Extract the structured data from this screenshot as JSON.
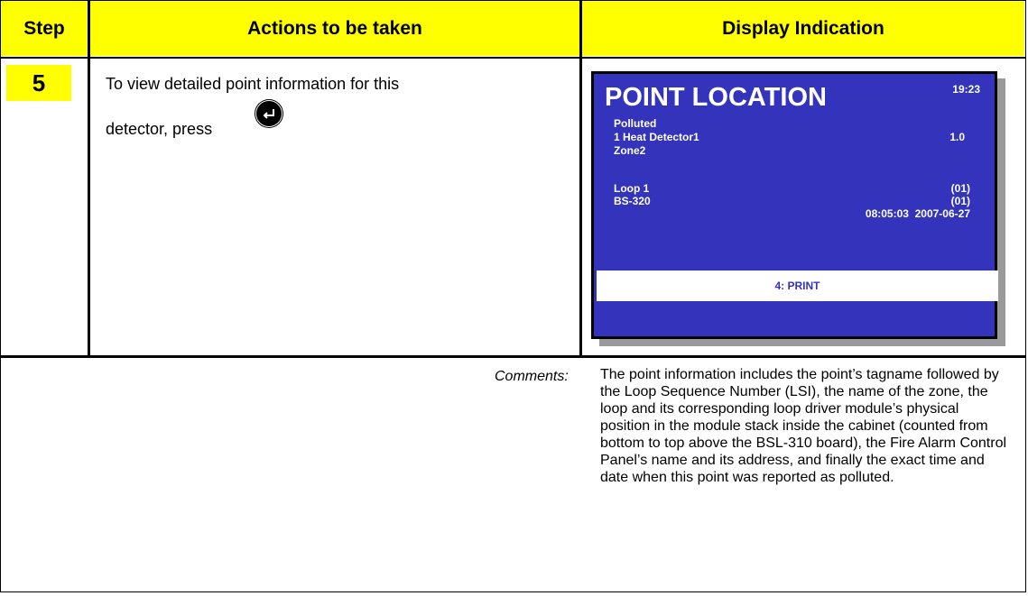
{
  "header": {
    "step": "Step",
    "actions": "Actions to be taken",
    "display": "Display Indication"
  },
  "row": {
    "step_number": "5",
    "action_line1": "To view detailed point information for this",
    "action_line2": "detector, press",
    "button_icon": "enter-icon"
  },
  "display": {
    "title": "POINT LOCATION",
    "time": "19:23",
    "status": "Polluted",
    "detector_name": "1 Heat Detector1",
    "detector_value": "1.0",
    "zone": "Zone2",
    "loop_label": "Loop 1",
    "loop_value": "(01)",
    "panel_label": "BS-320",
    "panel_value": "(01)",
    "datetime": "08:05:03  2007-06-27",
    "softkey": "4: PRINT",
    "colors": {
      "background": "#3333bb",
      "text": "#ffffff"
    }
  },
  "comments": {
    "label": "Comments:",
    "text": "The point information includes the point’s tagname followed by the Loop Sequence Number (LSI), the name of the zone, the loop and its corresponding loop driver module’s physical position in the module stack inside the cabinet (counted from bottom to top above the BSL-310 board), the Fire Alarm Control Panel’s name and its address, and finally the exact time and date when this point was reported as polluted."
  },
  "colors": {
    "header_bg": "#ffff00"
  }
}
